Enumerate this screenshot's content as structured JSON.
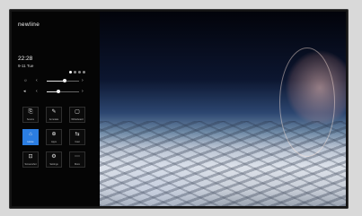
{
  "sidebar": {
    "brand": "newline",
    "time": "22:28",
    "date": "9-11 Tue",
    "pager": {
      "pages": 4,
      "active": 0
    },
    "brightness": {
      "icon": "sun-icon",
      "level": 0.55
    },
    "volume": {
      "icon": "speaker-icon",
      "level": 0.35
    },
    "tiles": [
      {
        "icon": "input-source-icon",
        "glyph": "⎘",
        "label": "Source"
      },
      {
        "icon": "pen-icon",
        "glyph": "✎",
        "label": "Annotate"
      },
      {
        "icon": "whiteboard-icon",
        "glyph": "▢",
        "label": "Whiteboard"
      },
      {
        "icon": "home-icon",
        "glyph": "⌂",
        "label": "Home",
        "active": true
      },
      {
        "icon": "apps-icon",
        "glyph": "⊕",
        "label": "Apps"
      },
      {
        "icon": "cast-icon",
        "glyph": "⇆",
        "label": "Cast"
      },
      {
        "icon": "screenshot-icon",
        "glyph": "⊡",
        "label": "Screenshot"
      },
      {
        "icon": "settings-icon",
        "glyph": "⚙",
        "label": "Settings"
      },
      {
        "icon": "more-icon",
        "glyph": "⋯",
        "label": "More"
      }
    ]
  },
  "colors": {
    "accent": "#2b7de1",
    "sidebar_bg": "#050505"
  }
}
